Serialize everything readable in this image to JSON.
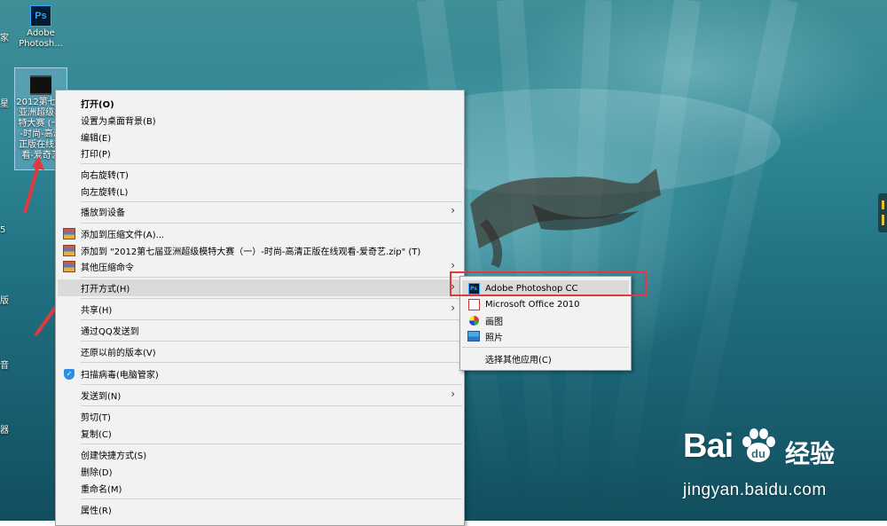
{
  "desktop": {
    "icons": [
      {
        "id": "photoshop",
        "label": "Adobe Photosh...",
        "tile": "Ps"
      },
      {
        "id": "video",
        "label": "2012第七届亚洲超级模特大赛 (一) -时尚-高清正版在线观看-爱奇艺"
      }
    ],
    "edge_labels": [
      "家",
      "星",
      "5",
      "版",
      "音",
      "器"
    ]
  },
  "context_menu": {
    "items": [
      {
        "label": "打开(O)",
        "bold": true
      },
      {
        "label": "设置为桌面背景(B)"
      },
      {
        "label": "编辑(E)"
      },
      {
        "label": "打印(P)"
      },
      {
        "label": "向右旋转(T)"
      },
      {
        "label": "向左旋转(L)"
      },
      {
        "label": "播放到设备",
        "submenu": true
      },
      {
        "label": "添加到压缩文件(A)...",
        "icon": "winrar-icon"
      },
      {
        "label": "添加到 \"2012第七届亚洲超级模特大赛（一）-时尚-高清正版在线观看-爱奇艺.zip\" (T)",
        "icon": "winrar-icon"
      },
      {
        "label": "其他压缩命令",
        "icon": "winrar-icon",
        "submenu": true
      },
      {
        "label": "打开方式(H)",
        "submenu": true,
        "highlighted": true
      },
      {
        "label": "共享(H)",
        "submenu": true
      },
      {
        "label": "通过QQ发送到"
      },
      {
        "label": "还原以前的版本(V)"
      },
      {
        "label": "扫描病毒(电脑管家)",
        "icon": "shield-icon"
      },
      {
        "label": "发送到(N)",
        "submenu": true
      },
      {
        "label": "剪切(T)"
      },
      {
        "label": "复制(C)"
      },
      {
        "label": "创建快捷方式(S)"
      },
      {
        "label": "删除(D)"
      },
      {
        "label": "重命名(M)"
      },
      {
        "label": "属性(R)"
      }
    ]
  },
  "open_with_menu": {
    "items": [
      {
        "label": "Adobe Photoshop CC",
        "icon": "photoshop-icon",
        "highlighted": true
      },
      {
        "label": "Microsoft Office 2010",
        "icon": "office-icon"
      },
      {
        "label": "画图",
        "icon": "paint-icon"
      },
      {
        "label": "照片",
        "icon": "photos-icon"
      },
      {
        "label": "选择其他应用(C)"
      }
    ]
  },
  "watermark": {
    "logo": "Bai du 经验",
    "url": "jingyan.baidu.com"
  },
  "colors": {
    "menu_bg": "#f2f2f2",
    "menu_highlight": "#dadada",
    "annotation_red": "#e0393e"
  }
}
